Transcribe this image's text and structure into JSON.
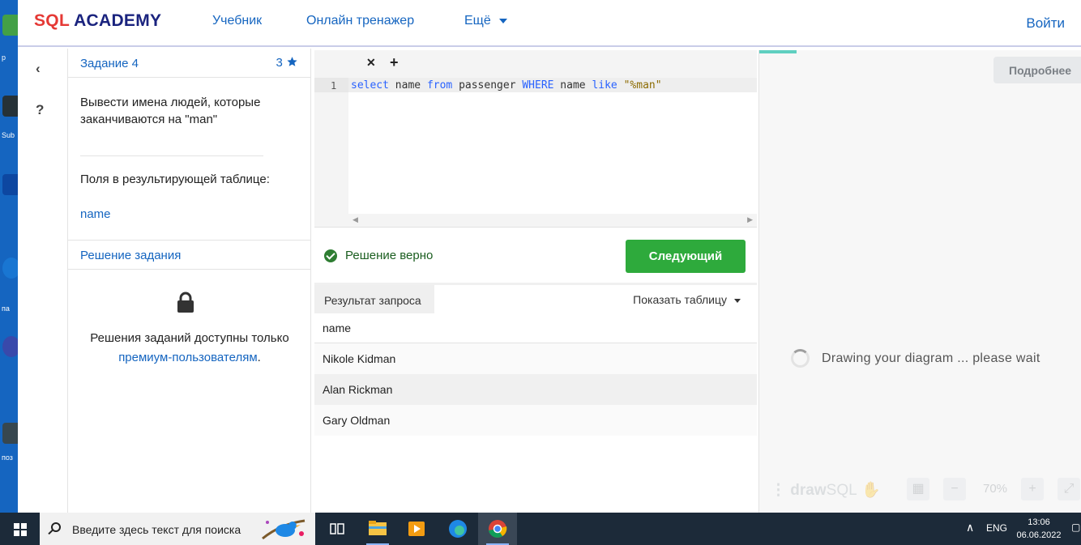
{
  "header": {
    "logo_sql": "SQL",
    "logo_academy": "ACADEMY",
    "nav_tutorial": "Учебник",
    "nav_trainer": "Онлайн тренажер",
    "nav_more": "Ещё",
    "login": "Войти"
  },
  "task": {
    "title": "Задание 4",
    "score": "3",
    "description": "Вывести имена людей, которые заканчиваются на \"man\"",
    "fields_label": "Поля в результирующей таблице:",
    "fields_value": "name",
    "solution_title": "Решение задания",
    "premium_text": "Решения заданий доступны только",
    "premium_link": "премиум-пользователям",
    "premium_suffix": "."
  },
  "editor": {
    "line_number": "1",
    "code_select": "select",
    "code_name": " name ",
    "code_from": "from",
    "code_table": " passenger ",
    "code_where": "WHERE",
    "code_col": " name ",
    "code_like": "like",
    "code_string": " \"%man\"",
    "status": "Решение верно",
    "next_button": "Следующий",
    "result_tab": "Результат запроса",
    "show_table": "Показать таблицу"
  },
  "results": {
    "column": "name",
    "rows": [
      "Nikole Kidman",
      "Alan Rickman",
      "Gary Oldman"
    ]
  },
  "diagram": {
    "more_button": "Подробнее",
    "wait_text": "Drawing your diagram ... please wait",
    "logo_bold": "draw",
    "logo_thin": "SQL",
    "zoom": "70%"
  },
  "taskbar": {
    "search_placeholder": "Введите здесь текст для поиска",
    "language": "ENG",
    "time": "13:06",
    "date": "06.06.2022"
  },
  "desktop": {
    "labels": [
      "р",
      "Sub",
      "па",
      "поз"
    ]
  },
  "colors": {
    "brand_blue": "#1565c0",
    "logo_red": "#e53935",
    "success_green": "#2eaa3c"
  }
}
